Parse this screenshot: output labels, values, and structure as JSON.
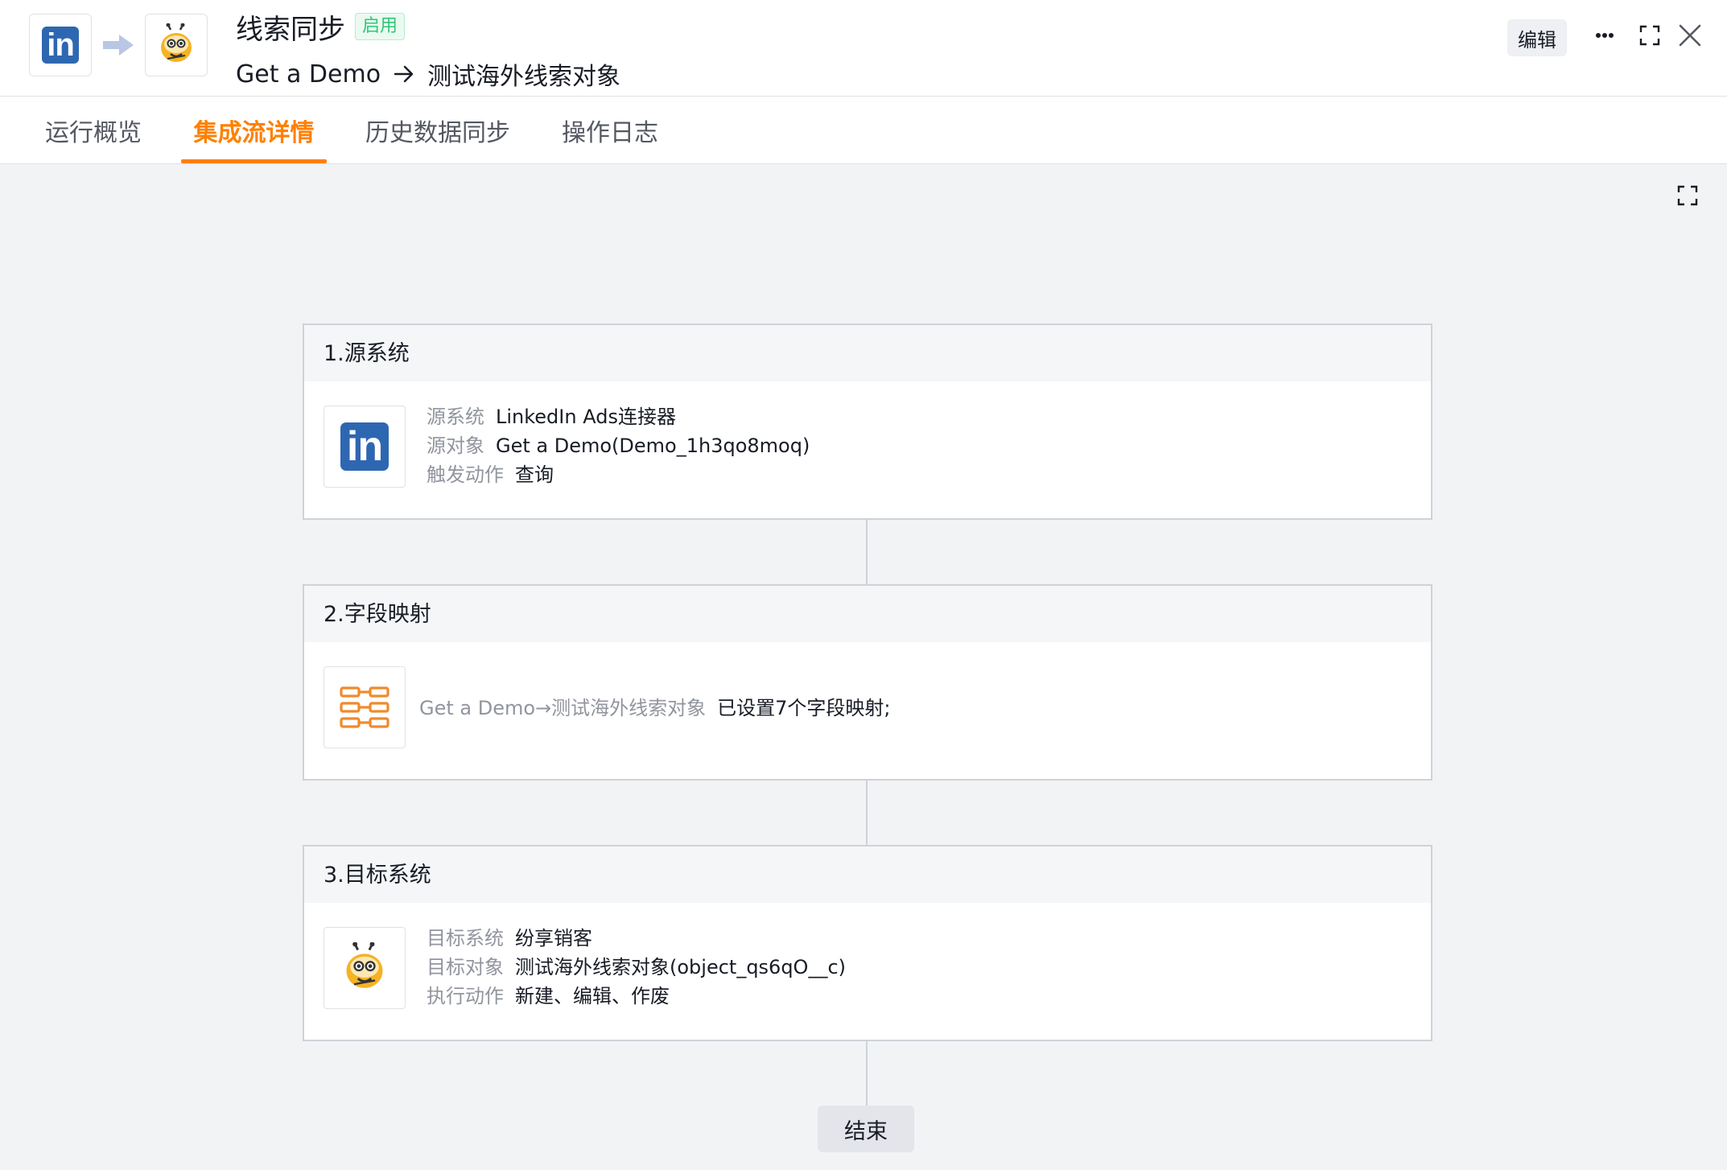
{
  "header": {
    "title": "线索同步",
    "status_badge": "启用",
    "source_object": "Get a Demo",
    "target_object": "测试海外线索对象",
    "edit_label": "编辑",
    "linkedin_glyph": "in",
    "icons": [
      "linkedin-logo",
      "arrow-right-icon",
      "bee-logo",
      "more-icon",
      "fullscreen-icon",
      "close-icon"
    ]
  },
  "tabs": [
    {
      "label": "运行概览",
      "active": false
    },
    {
      "label": "集成流详情",
      "active": true
    },
    {
      "label": "历史数据同步",
      "active": false
    },
    {
      "label": "操作日志",
      "active": false
    }
  ],
  "colors": {
    "accent": "#ff8000",
    "linkedin": "#2e67b1",
    "enabled": "#30c776",
    "canvas_bg": "#f2f3f5"
  },
  "flow": {
    "source": {
      "title": "1.源系统",
      "rows": [
        {
          "label": "源系统",
          "value": "LinkedIn Ads连接器"
        },
        {
          "label": "源对象",
          "value": "Get a Demo(Demo_1h3qo8moq)"
        },
        {
          "label": "触发动作",
          "value": "查询"
        }
      ]
    },
    "mapping": {
      "title": "2.字段映射",
      "label": "Get a Demo→测试海外线索对象",
      "value": "已设置7个字段映射;"
    },
    "target": {
      "title": "3.目标系统",
      "rows": [
        {
          "label": "目标系统",
          "value": "纷享销客"
        },
        {
          "label": "目标对象",
          "value": "测试海外线索对象(object_qs6qO__c)"
        },
        {
          "label": "执行动作",
          "value": "新建、编辑、作废"
        }
      ]
    },
    "end_label": "结束"
  }
}
